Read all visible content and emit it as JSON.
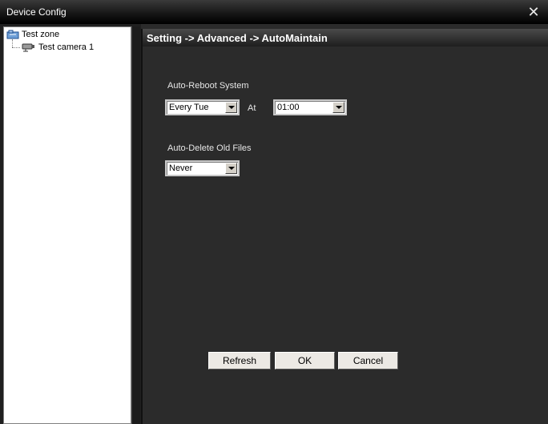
{
  "window": {
    "title": "Device Config",
    "close_icon": "close-icon"
  },
  "tree": {
    "root": {
      "label": "Test zone",
      "icon": "zone-icon"
    },
    "children": [
      {
        "label": "Test camera 1",
        "icon": "camera-icon"
      }
    ]
  },
  "panel": {
    "header": "Setting -> Advanced -> AutoMaintain",
    "auto_reboot": {
      "label": "Auto-Reboot System",
      "day_value": "Every Tue",
      "at_label": "At",
      "time_value": "01:00"
    },
    "auto_delete": {
      "label": "Auto-Delete Old Files",
      "value": "Never"
    },
    "buttons": {
      "refresh": "Refresh",
      "ok": "OK",
      "cancel": "Cancel"
    }
  }
}
